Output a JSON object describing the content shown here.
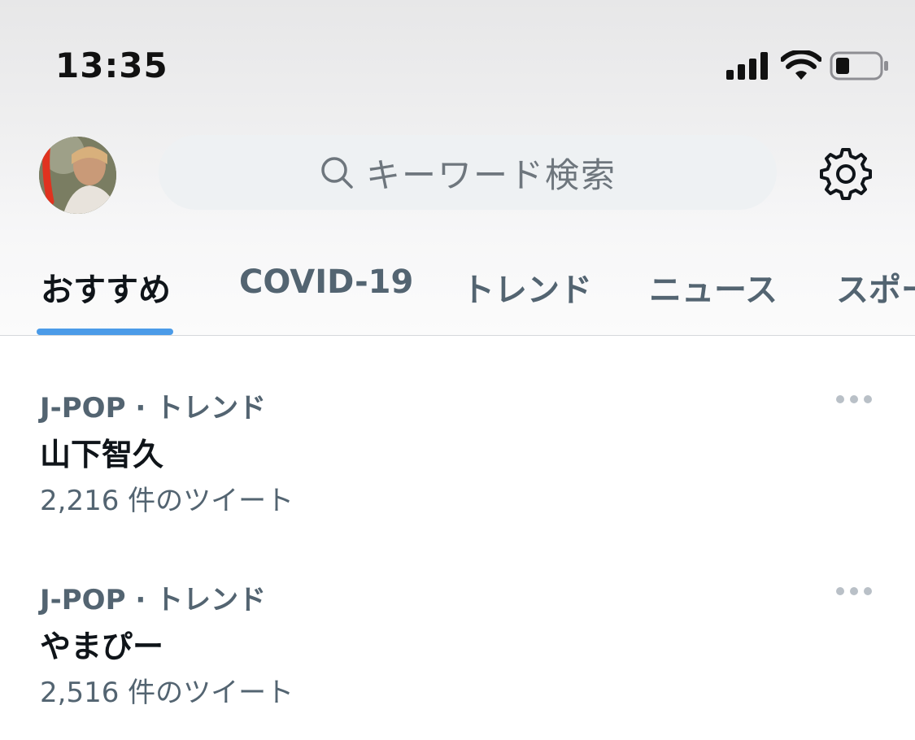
{
  "status_bar": {
    "time": "13:35",
    "icons": [
      "cellular-signal-icon",
      "wifi-icon",
      "battery-icon"
    ]
  },
  "header": {
    "avatar_icon": "avatar",
    "search": {
      "placeholder": "キーワード検索",
      "icon": "search-icon"
    },
    "settings_icon": "gear-icon"
  },
  "tabs": [
    {
      "label": "おすすめ",
      "active": true
    },
    {
      "label": "COVID-19",
      "active": false
    },
    {
      "label": "トレンド",
      "active": false
    },
    {
      "label": "ニュース",
      "active": false
    },
    {
      "label": "スポー",
      "active": false
    }
  ],
  "trends": [
    {
      "meta": "J-POP · トレンド",
      "title": "山下智久",
      "count": "2,216 件のツイート"
    },
    {
      "meta": "J-POP · トレンド",
      "title": "やまぴー",
      "count": "2,516 件のツイート"
    }
  ],
  "colors": {
    "accent": "#4b9be8",
    "secondary_text": "#536471",
    "primary_text": "#0f1419",
    "search_bg": "#eef1f3"
  }
}
